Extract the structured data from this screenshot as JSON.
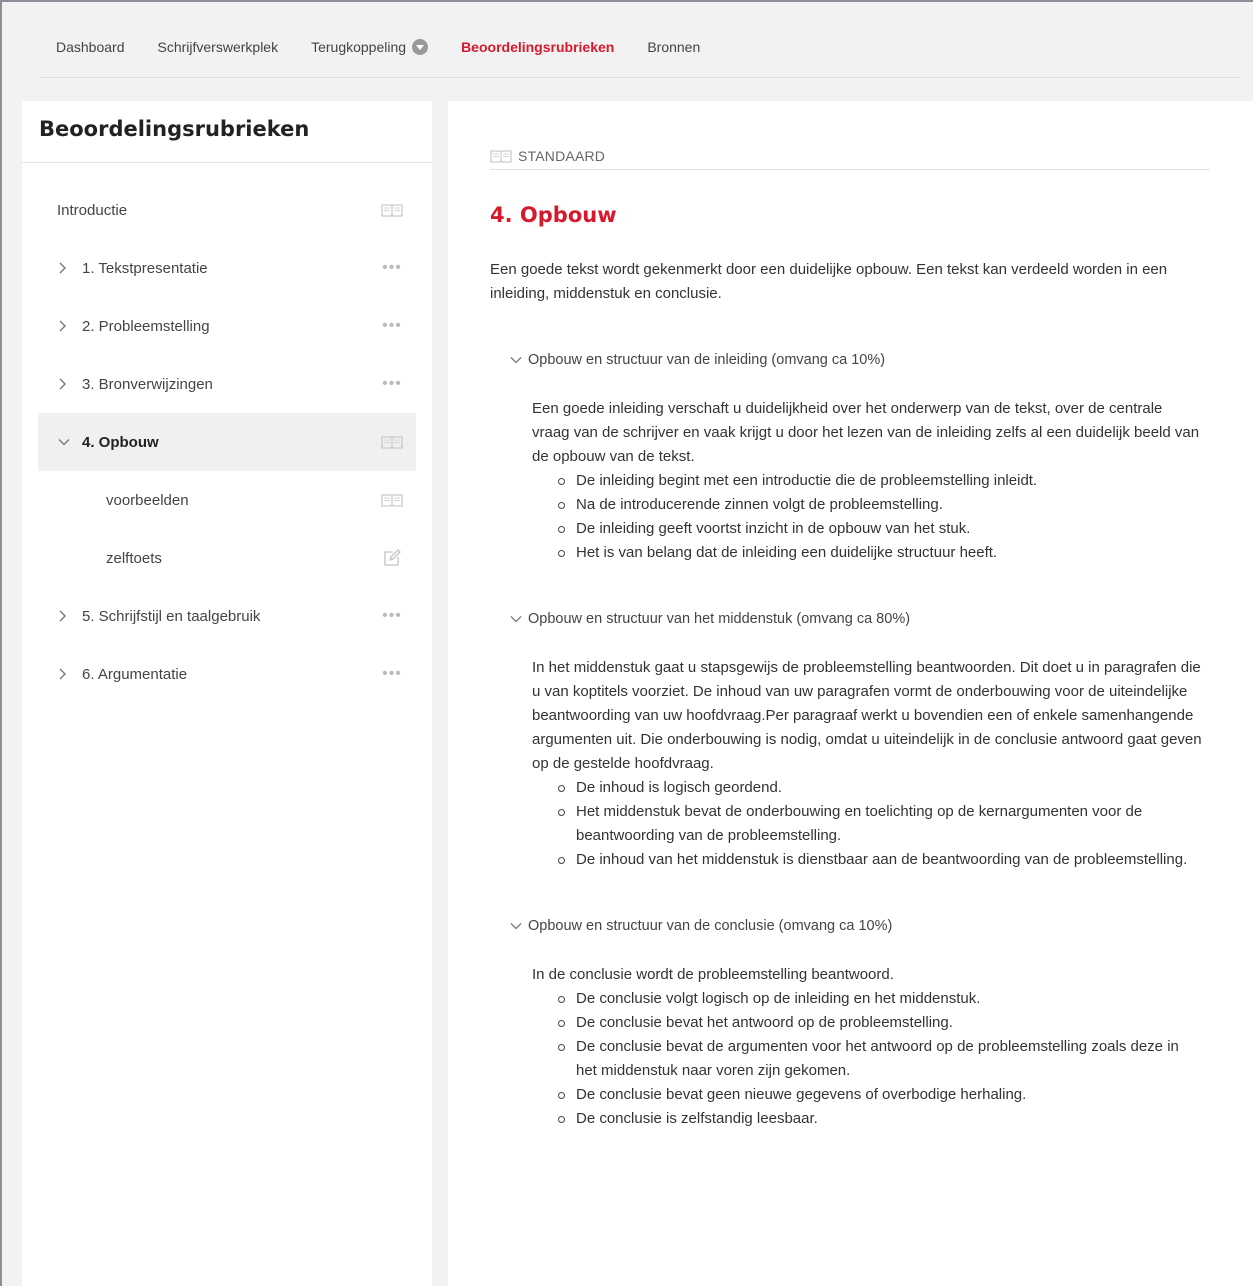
{
  "topnav": {
    "items": [
      {
        "label": "Dashboard",
        "active": false
      },
      {
        "label": "Schrijfverswerkplek",
        "active": false
      },
      {
        "label": "Terugkoppeling",
        "active": false,
        "dropdown": true
      },
      {
        "label": "Beoordelingsrubrieken",
        "active": true
      },
      {
        "label": "Bronnen",
        "active": false
      }
    ]
  },
  "sidebar": {
    "title": "Beoordelingsrubrieken",
    "items": [
      {
        "label": "Introductie",
        "icon": "book-icon"
      },
      {
        "label": "1. Tekstpresentatie",
        "icon": "more-dots-icon"
      },
      {
        "label": "2. Probleemstelling",
        "icon": "more-dots-icon"
      },
      {
        "label": "3. Bronverwijzingen",
        "icon": "more-dots-icon"
      },
      {
        "label": "4. Opbouw",
        "icon": "book-icon",
        "expanded": true,
        "selected": true
      },
      {
        "label": "voorbeelden",
        "icon": "book-icon",
        "sub": true
      },
      {
        "label": "zelftoets",
        "icon": "edit-icon",
        "sub": true
      },
      {
        "label": "5. Schrijfstijl en taalgebruik",
        "icon": "more-dots-icon"
      },
      {
        "label": "6. Argumentatie",
        "icon": "more-dots-icon"
      }
    ]
  },
  "content": {
    "standard_label": "STANDAARD",
    "title": "4. Opbouw",
    "intro": "Een goede tekst wordt gekenmerkt door een duidelijke opbouw. Een tekst kan verdeeld worden in een inleiding, middenstuk en conclusie.",
    "sections": [
      {
        "heading": "Opbouw en structuur van de inleiding (omvang ca 10%)",
        "text": "Een goede inleiding verschaft u duidelijkheid over het onderwerp van de tekst, over de centrale vraag van de schrijver en vaak krijgt u door het lezen van de inleiding zelfs al een duidelijk beeld van de opbouw van de tekst.",
        "bullets": [
          "De inleiding begint met een introductie die de probleemstelling inleidt.",
          "Na de introducerende zinnen volgt de probleemstelling.",
          "De inleiding geeft voortst inzicht in de opbouw van het stuk.",
          "Het is van belang dat de inleiding een duidelijke structuur heeft."
        ]
      },
      {
        "heading": "Opbouw en structuur van het middenstuk (omvang ca 80%)",
        "text": "In het middenstuk gaat u stapsgewijs de probleemstelling beantwoorden. Dit doet u in paragrafen die u van koptitels voorziet. De inhoud van uw paragrafen vormt de onderbouwing voor de uiteindelijke beantwoording van uw hoofdvraag.Per paragraaf werkt u bovendien een of enkele samenhangende argumenten uit. Die onderbouwing is nodig, omdat u uiteindelijk in de conclusie antwoord gaat geven op de gestelde hoofdvraag.",
        "bullets": [
          "De inhoud is logisch geordend.",
          "Het middenstuk bevat de onderbouwing en toelichting op de kernargumenten voor de beantwoording van de probleemstelling.",
          "De inhoud van het middenstuk is dienstbaar aan de beantwoording van de probleemstelling."
        ]
      },
      {
        "heading": "Opbouw en structuur van de conclusie (omvang ca 10%)",
        "text": "In de conclusie wordt de probleemstelling beantwoord.",
        "bullets": [
          "De conclusie volgt logisch op de inleiding en het middenstuk.",
          "De conclusie bevat het antwoord op de probleemstelling.",
          "De conclusie bevat de argumenten voor het antwoord op de probleemstelling zoals deze in het middenstuk naar voren zijn gekomen.",
          "De conclusie bevat geen nieuwe gegevens of overbodige herhaling.",
          "De conclusie is zelfstandig leesbaar."
        ]
      }
    ]
  }
}
